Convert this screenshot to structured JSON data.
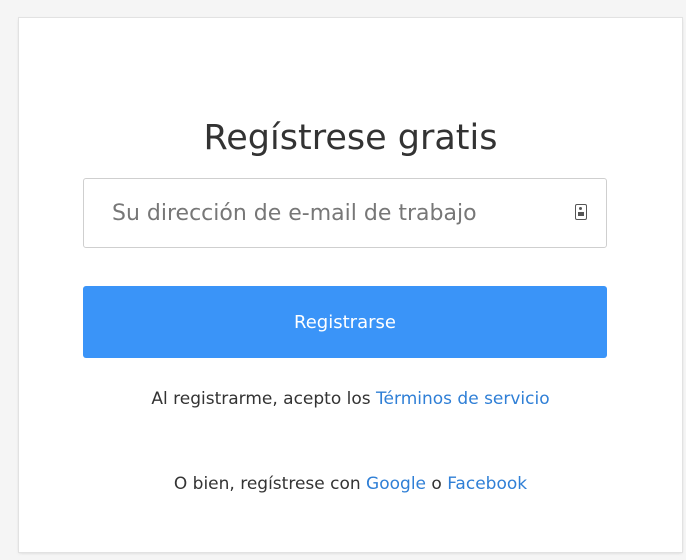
{
  "signup": {
    "title": "Regístrese gratis",
    "email_placeholder": "Su dirección de e-mail de trabajo",
    "email_value": "",
    "contact_icon": "contact-card-icon",
    "register_label": "Registrarse",
    "terms_prefix": "Al registrarme, acepto los ",
    "terms_link": "Términos de servicio",
    "social_prefix": "O bien, regístrese con ",
    "google_link": "Google",
    "social_or": " o ",
    "facebook_link": "Facebook"
  },
  "colors": {
    "primary_button": "#3a94f8",
    "link": "#2f7fd6",
    "text": "#333333",
    "background": "#f5f5f5",
    "card": "#ffffff"
  }
}
